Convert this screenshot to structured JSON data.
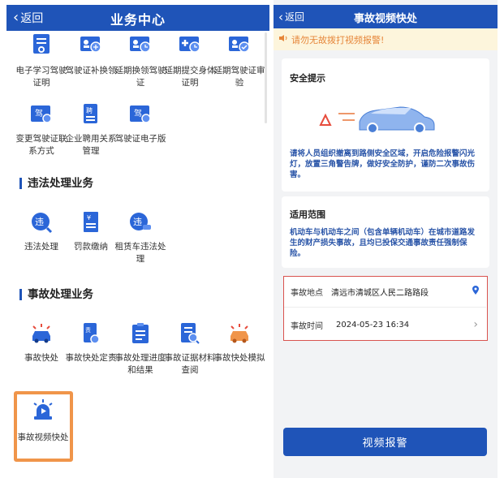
{
  "left": {
    "back_label": "返回",
    "title": "业务中心",
    "top_items": [
      {
        "label": "电子学习驾驶证明",
        "icon": "study-certificate-icon"
      },
      {
        "label": "驾驶证补换领",
        "icon": "license-replace-icon"
      },
      {
        "label": "延期换领驾驶证",
        "icon": "license-extend-icon"
      },
      {
        "label": "延期提交身体证明",
        "icon": "health-extend-icon"
      },
      {
        "label": "延期驾驶证审验",
        "icon": "license-audit-icon"
      },
      {
        "label": "变更驾驶证联系方式",
        "icon": "contact-change-icon"
      },
      {
        "label": "企业聘用关系管理",
        "icon": "employment-icon"
      },
      {
        "label": "驾驶证电子版",
        "icon": "e-license-icon"
      }
    ],
    "section_violation": "违法处理业务",
    "violation_items": [
      {
        "label": "违法处理",
        "icon": "violation-icon"
      },
      {
        "label": "罚款缴纳",
        "icon": "fine-payment-icon"
      },
      {
        "label": "租赁车违法处理",
        "icon": "rental-violation-icon"
      }
    ],
    "section_accident": "事故处理业务",
    "accident_items": [
      {
        "label": "事故快处",
        "icon": "accident-quick-icon"
      },
      {
        "label": "事故快处定责",
        "icon": "accident-liability-icon"
      },
      {
        "label": "事故处理进度和结果",
        "icon": "accident-progress-icon"
      },
      {
        "label": "事故证据材料查阅",
        "icon": "evidence-query-icon"
      },
      {
        "label": "事故快处模拟",
        "icon": "accident-simulate-icon"
      },
      {
        "label": "事故视频快处",
        "icon": "video-accident-icon"
      }
    ]
  },
  "right": {
    "back_label": "返回",
    "title": "事故视频快处",
    "warning": "请勿无故拨打视频报警!",
    "safety_title": "安全提示",
    "safety_text": "请将人员组织撤离到路侧安全区域，开启危险报警闪光灯，放置三角警告牌，做好安全防护，谨防二次事故伤害。",
    "scope_title": "适用范围",
    "scope_text": "机动车与机动车之间（包含单辆机动车）在城市道路发生的财产损失事故，且均已投保交通事故责任强制保险。",
    "location_label": "事故地点",
    "location_value": "清远市清城区人民二路路段",
    "time_label": "事故时间",
    "time_value": "2024-05-23 16:34",
    "button_label": "视频报警"
  },
  "colors": {
    "primary": "#1f54b8",
    "highlight": "#f0954a",
    "warning_text": "#e6863a",
    "form_border": "#d9534f"
  }
}
